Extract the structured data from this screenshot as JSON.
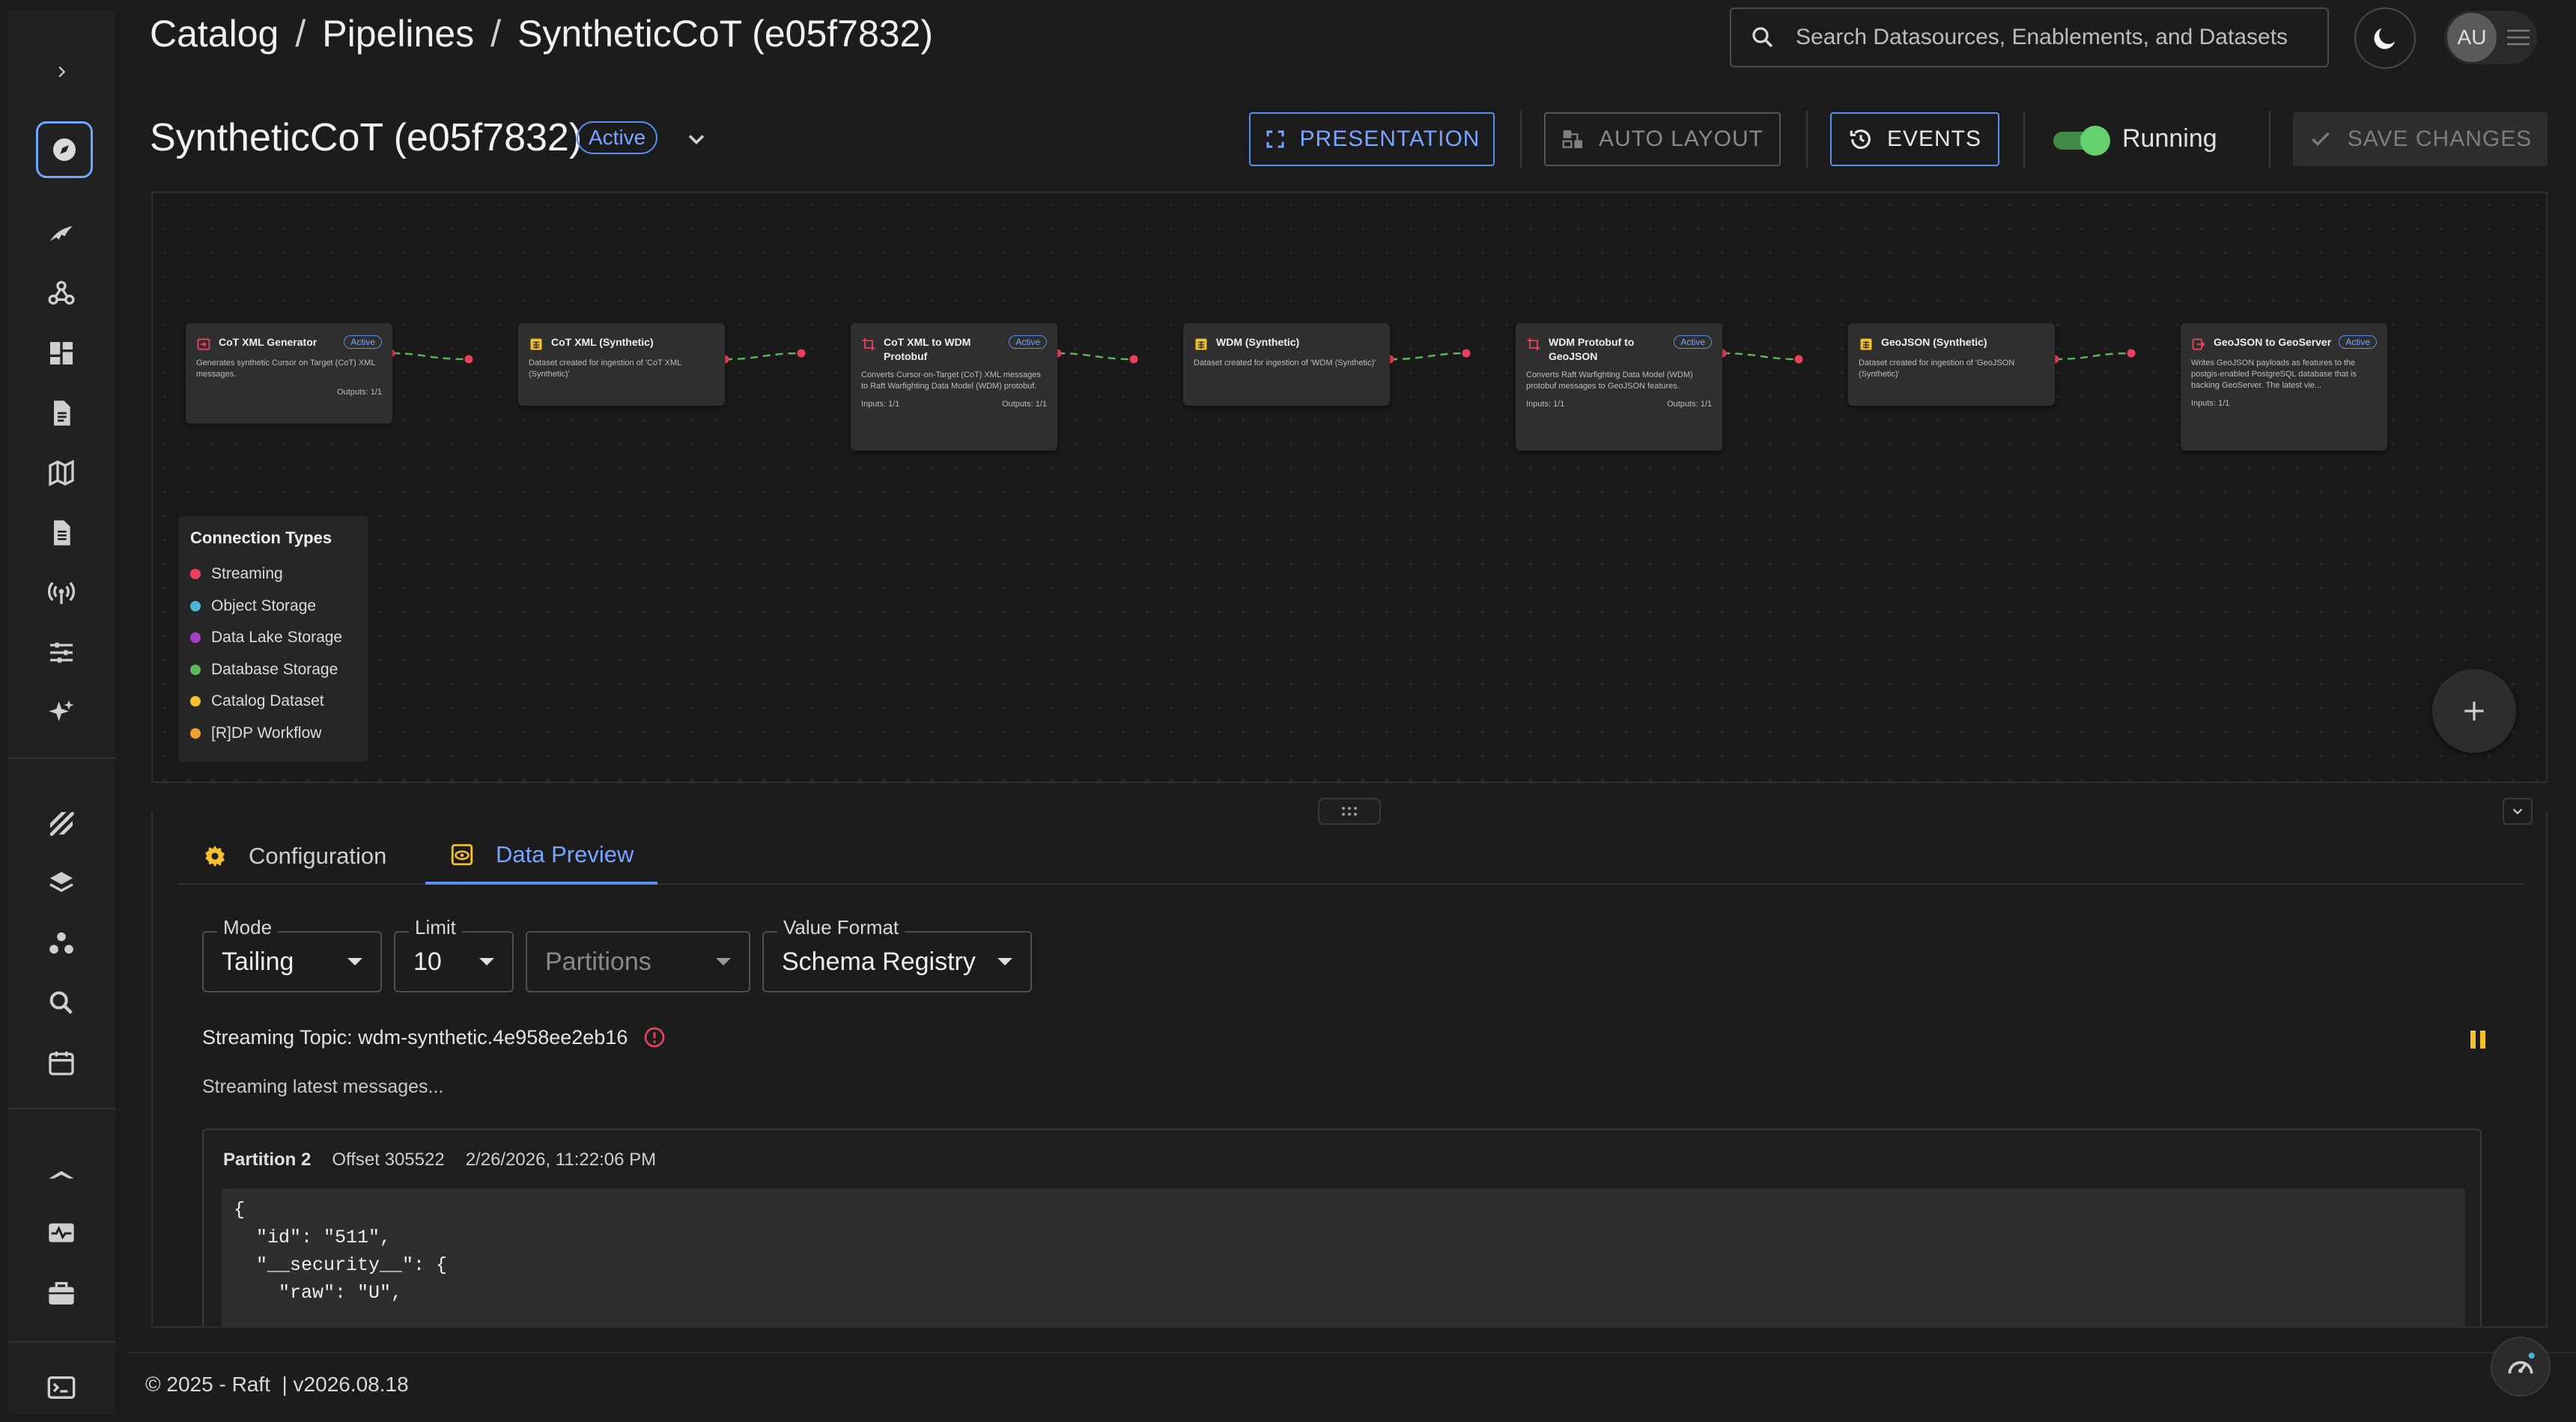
{
  "breadcrumb": {
    "items": [
      "Catalog",
      "Pipelines",
      "SyntheticCoT (e05f7832)"
    ],
    "separator": "/"
  },
  "search": {
    "placeholder": "Search Datasources, Enablements, and Datasets"
  },
  "user": {
    "initials": "AU"
  },
  "sidebar": {
    "expand_icon": "chevron-right-icon",
    "items": [
      "compass-icon",
      "wing-icon",
      "webhook-icon",
      "dashboard-icon",
      "document-icon",
      "map-icon",
      "file-icon",
      "broadcast-icon",
      "sliders-icon",
      "sparkle-icon",
      "stripes-icon",
      "layers-icon",
      "nodes-icon",
      "search-icon",
      "calendar-icon",
      "tent-icon",
      "monitor-pulse-icon",
      "briefcase-icon",
      "terminal-icon"
    ],
    "active": "compass-icon"
  },
  "pipeline": {
    "title": "SyntheticCoT (e05f7832)",
    "status": "Active"
  },
  "toolbar": {
    "presentation": "PRESENTATION",
    "auto_layout": "AUTO LAYOUT",
    "events": "EVENTS",
    "running_label": "Running",
    "running": true,
    "save": "SAVE CHANGES"
  },
  "nodes": [
    {
      "title": "CoT XML Generator",
      "badge": "Active",
      "icon": "source-icon",
      "desc": "Generates synthetic Cursor on Target (CoT) XML messages.",
      "inputs": "",
      "outputs": "Outputs: 1/1"
    },
    {
      "title": "CoT XML (Synthetic)",
      "badge": "",
      "icon": "dataset-icon",
      "desc": "Dataset created for ingestion of 'CoT XML (Synthetic)'",
      "inputs": "",
      "outputs": ""
    },
    {
      "title": "CoT XML to WDM Protobuf",
      "badge": "Active",
      "icon": "transform-icon",
      "desc": "Converts Cursor-on-Target (CoT) XML messages to Raft Warfighting Data Model (WDM) protobuf.",
      "inputs": "Inputs: 1/1",
      "outputs": "Outputs: 1/1"
    },
    {
      "title": "WDM (Synthetic)",
      "badge": "",
      "icon": "dataset-icon",
      "desc": "Dataset created for ingestion of 'WDM (Synthetic)'",
      "inputs": "",
      "outputs": ""
    },
    {
      "title": "WDM Protobuf to GeoJSON",
      "badge": "Active",
      "icon": "transform-icon",
      "desc": "Converts Raft Warfighting Data Model (WDM) protobuf messages to GeoJSON features.",
      "inputs": "Inputs: 1/1",
      "outputs": "Outputs: 1/1"
    },
    {
      "title": "GeoJSON (Synthetic)",
      "badge": "",
      "icon": "dataset-icon",
      "desc": "Dataset created for ingestion of 'GeoJSON (Synthetic)'",
      "inputs": "",
      "outputs": ""
    },
    {
      "title": "GeoJSON to GeoServer",
      "badge": "Active",
      "icon": "sink-icon",
      "desc": "Writes GeoJSON payloads as features to the postgis-enabled PostgreSQL database that is backing GeoServer. The latest vie...",
      "inputs": "Inputs: 1/1",
      "outputs": ""
    }
  ],
  "legend": {
    "title": "Connection Types",
    "items": [
      {
        "label": "Streaming",
        "color": "#e8405e"
      },
      {
        "label": "Object Storage",
        "color": "#4fb3d9"
      },
      {
        "label": "Data Lake Storage",
        "color": "#a742c9"
      },
      {
        "label": "Database Storage",
        "color": "#5cb85c"
      },
      {
        "label": "Catalog Dataset",
        "color": "#f2c12e"
      },
      {
        "label": "[R]DP Workflow",
        "color": "#f0a030"
      }
    ]
  },
  "tabs": {
    "configuration": "Configuration",
    "data_preview": "Data Preview",
    "active": "Data Preview"
  },
  "preview": {
    "mode_label": "Mode",
    "mode_value": "Tailing",
    "limit_label": "Limit",
    "limit_value": "10",
    "partitions_placeholder": "Partitions",
    "format_label": "Value Format",
    "format_value": "Schema Registry",
    "topic": "Streaming Topic: wdm-synthetic.4e958ee2eb16",
    "status": "Streaming latest messages...",
    "message": {
      "partition": "Partition 2",
      "offset": "Offset 305522",
      "timestamp": "2/26/2026, 11:22:06 PM",
      "body": "{\n  \"id\": \"511\",\n  \"__security__\": {\n    \"raw\": \"U\","
    }
  },
  "footer": {
    "text": "© 2025 - Raft  | v2026.08.18"
  },
  "colors": {
    "accent": "#5b8def",
    "streaming": "#e8405e",
    "running": "#65d06e",
    "warning": "#f2c12e",
    "error": "#e8405e"
  }
}
